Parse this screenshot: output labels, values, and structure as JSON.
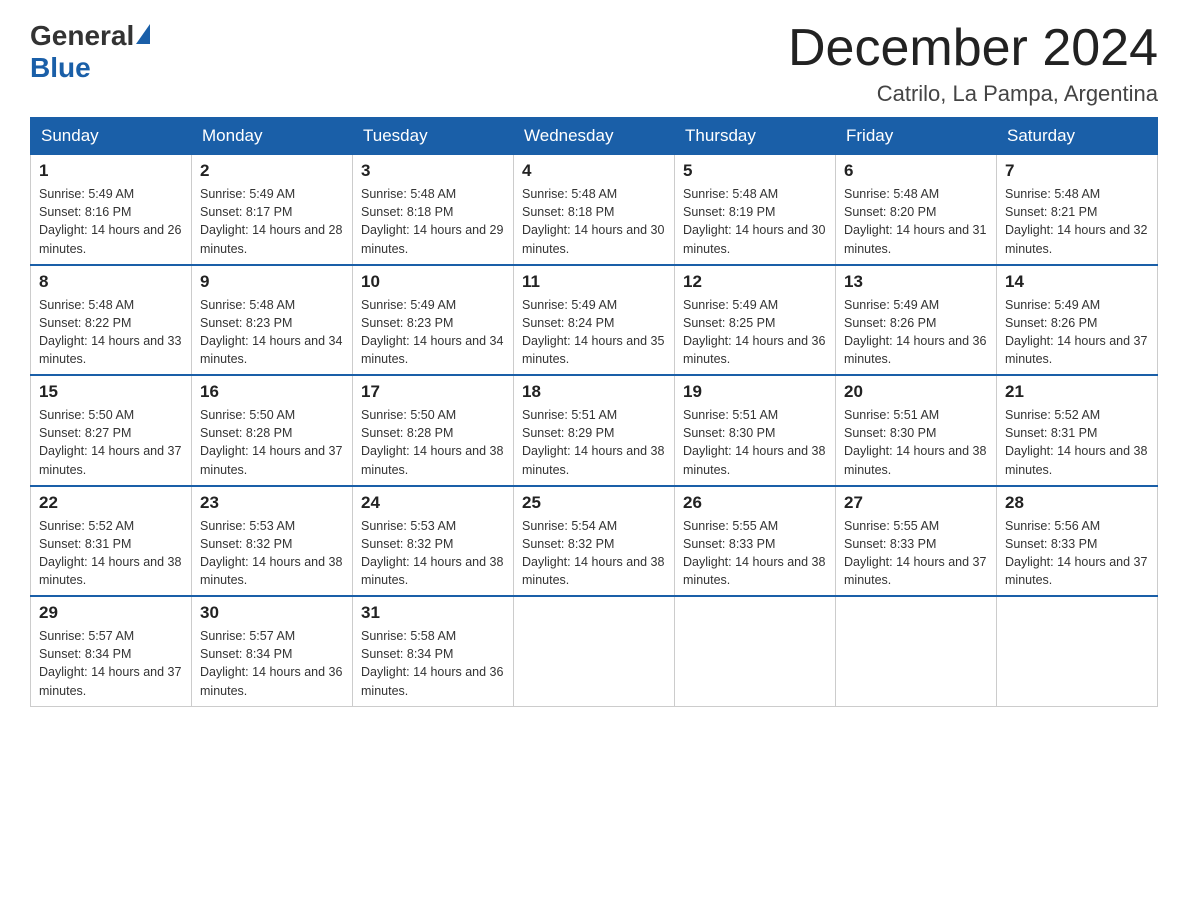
{
  "header": {
    "logo_general": "General",
    "logo_blue": "Blue",
    "month_title": "December 2024",
    "subtitle": "Catrilo, La Pampa, Argentina"
  },
  "weekdays": [
    "Sunday",
    "Monday",
    "Tuesday",
    "Wednesday",
    "Thursday",
    "Friday",
    "Saturday"
  ],
  "weeks": [
    [
      {
        "day": 1,
        "sunrise": "5:49 AM",
        "sunset": "8:16 PM",
        "daylight": "14 hours and 26 minutes."
      },
      {
        "day": 2,
        "sunrise": "5:49 AM",
        "sunset": "8:17 PM",
        "daylight": "14 hours and 28 minutes."
      },
      {
        "day": 3,
        "sunrise": "5:48 AM",
        "sunset": "8:18 PM",
        "daylight": "14 hours and 29 minutes."
      },
      {
        "day": 4,
        "sunrise": "5:48 AM",
        "sunset": "8:18 PM",
        "daylight": "14 hours and 30 minutes."
      },
      {
        "day": 5,
        "sunrise": "5:48 AM",
        "sunset": "8:19 PM",
        "daylight": "14 hours and 30 minutes."
      },
      {
        "day": 6,
        "sunrise": "5:48 AM",
        "sunset": "8:20 PM",
        "daylight": "14 hours and 31 minutes."
      },
      {
        "day": 7,
        "sunrise": "5:48 AM",
        "sunset": "8:21 PM",
        "daylight": "14 hours and 32 minutes."
      }
    ],
    [
      {
        "day": 8,
        "sunrise": "5:48 AM",
        "sunset": "8:22 PM",
        "daylight": "14 hours and 33 minutes."
      },
      {
        "day": 9,
        "sunrise": "5:48 AM",
        "sunset": "8:23 PM",
        "daylight": "14 hours and 34 minutes."
      },
      {
        "day": 10,
        "sunrise": "5:49 AM",
        "sunset": "8:23 PM",
        "daylight": "14 hours and 34 minutes."
      },
      {
        "day": 11,
        "sunrise": "5:49 AM",
        "sunset": "8:24 PM",
        "daylight": "14 hours and 35 minutes."
      },
      {
        "day": 12,
        "sunrise": "5:49 AM",
        "sunset": "8:25 PM",
        "daylight": "14 hours and 36 minutes."
      },
      {
        "day": 13,
        "sunrise": "5:49 AM",
        "sunset": "8:26 PM",
        "daylight": "14 hours and 36 minutes."
      },
      {
        "day": 14,
        "sunrise": "5:49 AM",
        "sunset": "8:26 PM",
        "daylight": "14 hours and 37 minutes."
      }
    ],
    [
      {
        "day": 15,
        "sunrise": "5:50 AM",
        "sunset": "8:27 PM",
        "daylight": "14 hours and 37 minutes."
      },
      {
        "day": 16,
        "sunrise": "5:50 AM",
        "sunset": "8:28 PM",
        "daylight": "14 hours and 37 minutes."
      },
      {
        "day": 17,
        "sunrise": "5:50 AM",
        "sunset": "8:28 PM",
        "daylight": "14 hours and 38 minutes."
      },
      {
        "day": 18,
        "sunrise": "5:51 AM",
        "sunset": "8:29 PM",
        "daylight": "14 hours and 38 minutes."
      },
      {
        "day": 19,
        "sunrise": "5:51 AM",
        "sunset": "8:30 PM",
        "daylight": "14 hours and 38 minutes."
      },
      {
        "day": 20,
        "sunrise": "5:51 AM",
        "sunset": "8:30 PM",
        "daylight": "14 hours and 38 minutes."
      },
      {
        "day": 21,
        "sunrise": "5:52 AM",
        "sunset": "8:31 PM",
        "daylight": "14 hours and 38 minutes."
      }
    ],
    [
      {
        "day": 22,
        "sunrise": "5:52 AM",
        "sunset": "8:31 PM",
        "daylight": "14 hours and 38 minutes."
      },
      {
        "day": 23,
        "sunrise": "5:53 AM",
        "sunset": "8:32 PM",
        "daylight": "14 hours and 38 minutes."
      },
      {
        "day": 24,
        "sunrise": "5:53 AM",
        "sunset": "8:32 PM",
        "daylight": "14 hours and 38 minutes."
      },
      {
        "day": 25,
        "sunrise": "5:54 AM",
        "sunset": "8:32 PM",
        "daylight": "14 hours and 38 minutes."
      },
      {
        "day": 26,
        "sunrise": "5:55 AM",
        "sunset": "8:33 PM",
        "daylight": "14 hours and 38 minutes."
      },
      {
        "day": 27,
        "sunrise": "5:55 AM",
        "sunset": "8:33 PM",
        "daylight": "14 hours and 37 minutes."
      },
      {
        "day": 28,
        "sunrise": "5:56 AM",
        "sunset": "8:33 PM",
        "daylight": "14 hours and 37 minutes."
      }
    ],
    [
      {
        "day": 29,
        "sunrise": "5:57 AM",
        "sunset": "8:34 PM",
        "daylight": "14 hours and 37 minutes."
      },
      {
        "day": 30,
        "sunrise": "5:57 AM",
        "sunset": "8:34 PM",
        "daylight": "14 hours and 36 minutes."
      },
      {
        "day": 31,
        "sunrise": "5:58 AM",
        "sunset": "8:34 PM",
        "daylight": "14 hours and 36 minutes."
      },
      null,
      null,
      null,
      null
    ]
  ]
}
